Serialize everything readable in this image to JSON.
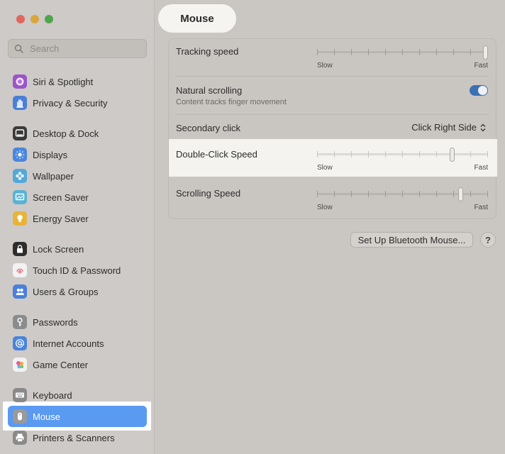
{
  "window": {
    "title": "Mouse"
  },
  "sidebar": {
    "search_placeholder": "Search",
    "items": [
      {
        "label": "Siri & Spotlight",
        "icon": "siri-icon",
        "color": "#9a55c9"
      },
      {
        "label": "Privacy & Security",
        "icon": "hand-icon",
        "color": "#4a7fd6"
      },
      {
        "label": "Desktop & Dock",
        "icon": "dock-icon",
        "color": "#3a3a3a"
      },
      {
        "label": "Displays",
        "icon": "sun-icon",
        "color": "#4a86dd"
      },
      {
        "label": "Wallpaper",
        "icon": "flower-icon",
        "color": "#52a9d9"
      },
      {
        "label": "Screen Saver",
        "icon": "screen-saver-icon",
        "color": "#58b3d6"
      },
      {
        "label": "Energy Saver",
        "icon": "lightbulb-icon",
        "color": "#e8b33a"
      },
      {
        "label": "Lock Screen",
        "icon": "lock-icon",
        "color": "#2d2d2d"
      },
      {
        "label": "Touch ID & Password",
        "icon": "fingerprint-icon",
        "color": "#f2f2f2"
      },
      {
        "label": "Users & Groups",
        "icon": "users-icon",
        "color": "#4a80d8"
      },
      {
        "label": "Passwords",
        "icon": "key-icon",
        "color": "#8c8c8c"
      },
      {
        "label": "Internet Accounts",
        "icon": "at-icon",
        "color": "#4a84dc"
      },
      {
        "label": "Game Center",
        "icon": "game-center-icon",
        "color": "#f2f2f2"
      },
      {
        "label": "Keyboard",
        "icon": "keyboard-icon",
        "color": "#8a8a8a"
      },
      {
        "label": "Mouse",
        "icon": "mouse-icon",
        "color": "#9a9a9a",
        "selected": true
      },
      {
        "label": "Printers & Scanners",
        "icon": "printer-icon",
        "color": "#8a8a8a"
      }
    ]
  },
  "settings": {
    "tracking_speed": {
      "label": "Tracking speed",
      "slow": "Slow",
      "fast": "Fast",
      "value": 1.0
    },
    "natural_scrolling": {
      "label": "Natural scrolling",
      "description": "Content tracks finger movement",
      "enabled": true
    },
    "secondary_click": {
      "label": "Secondary click",
      "value": "Click Right Side"
    },
    "double_click_speed": {
      "label": "Double-Click Speed",
      "slow": "Slow",
      "fast": "Fast",
      "value": 0.8
    },
    "scrolling_speed": {
      "label": "Scrolling Speed",
      "slow": "Slow",
      "fast": "Fast",
      "value": 0.85
    }
  },
  "footer": {
    "bluetooth_button": "Set Up Bluetooth Mouse...",
    "help_button": "?"
  },
  "colors": {
    "accent": "#5a9af0",
    "toggle_on": "#3d6fb4"
  }
}
